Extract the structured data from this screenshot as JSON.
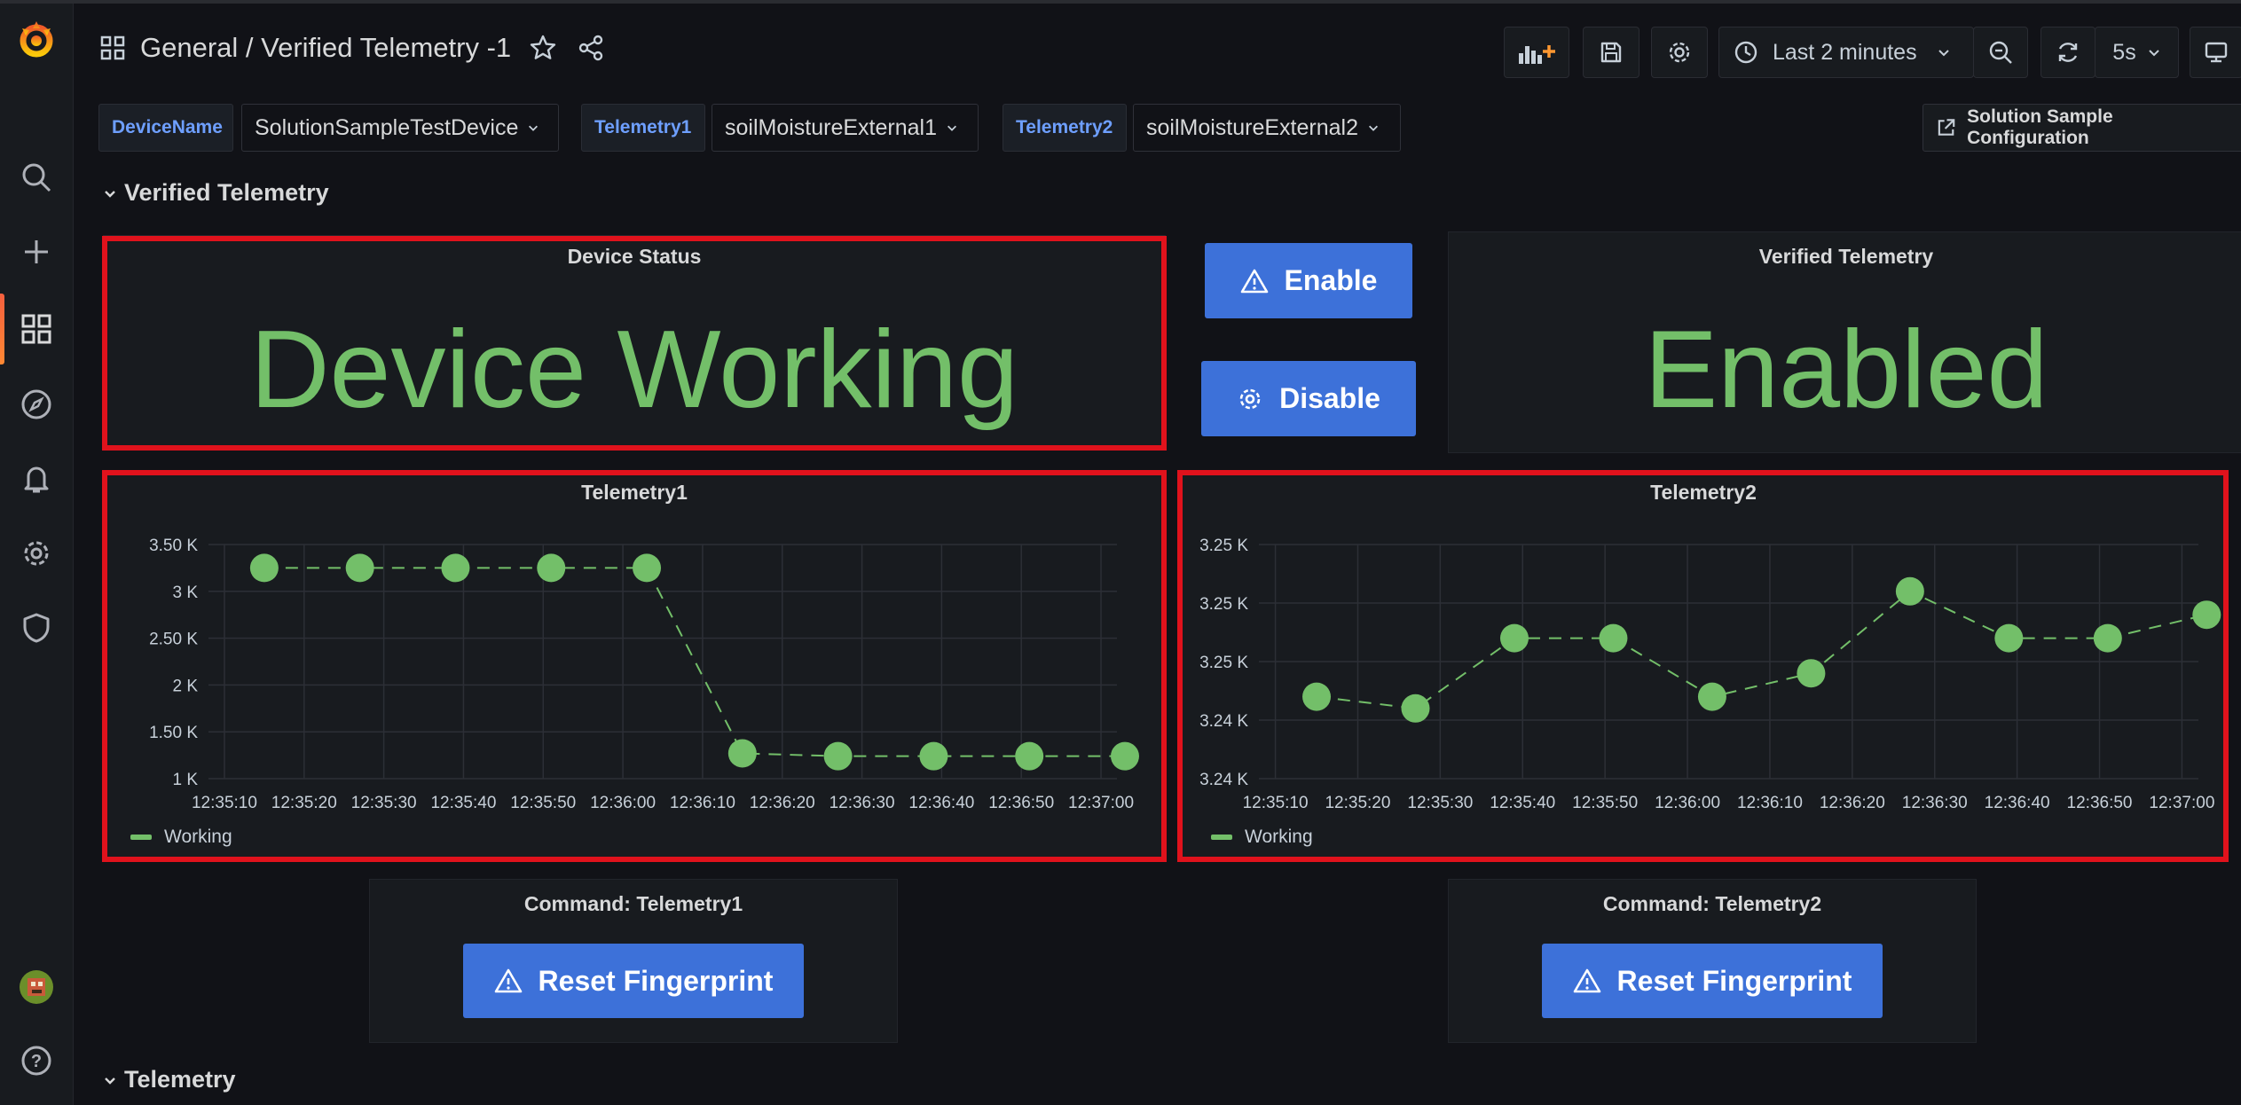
{
  "breadcrumb": {
    "folder": "General",
    "separator": " / ",
    "dashboard": "Verified Telemetry -1"
  },
  "toolbar": {
    "time_range": "Last 2 minutes",
    "refresh_interval": "5s"
  },
  "variables": [
    {
      "label": "DeviceName",
      "value": "SolutionSampleTestDevice"
    },
    {
      "label": "Telemetry1",
      "value": "soilMoistureExternal1"
    },
    {
      "label": "Telemetry2",
      "value": "soilMoistureExternal2"
    }
  ],
  "link": {
    "label": "Solution Sample Configuration"
  },
  "rows": {
    "verified": "Verified Telemetry",
    "telemetry": "Telemetry"
  },
  "panels": {
    "device_status": {
      "title": "Device Status",
      "value": "Device Working"
    },
    "enable_button": "Enable",
    "disable_button": "Disable",
    "verified_telemetry": {
      "title": "Verified Telemetry",
      "value": "Enabled"
    },
    "command1": {
      "title": "Command: Telemetry1",
      "button": "Reset Fingerprint"
    },
    "command2": {
      "title": "Command: Telemetry2",
      "button": "Reset Fingerprint"
    }
  },
  "colors": {
    "accent_green": "#73bf69",
    "button_blue": "#3d71d9",
    "highlight_red": "#e0121c",
    "background": "#111217"
  },
  "chart_data": [
    {
      "type": "line",
      "title": "Telemetry1",
      "x": [
        "12:35:10",
        "12:35:20",
        "12:35:30",
        "12:35:40",
        "12:35:50",
        "12:36:00",
        "12:36:10",
        "12:36:20",
        "12:36:30",
        "12:36:40",
        "12:36:50",
        "12:37:00"
      ],
      "y_ticks": [
        "3.50 K",
        "3 K",
        "2.50 K",
        "2 K",
        "1.50 K",
        "1 K"
      ],
      "ylim": [
        1000,
        3500
      ],
      "series": [
        {
          "name": "Working",
          "points": [
            [
              "12:35:15",
              3250
            ],
            [
              "12:35:27",
              3250
            ],
            [
              "12:35:39",
              3250
            ],
            [
              "12:35:51",
              3250
            ],
            [
              "12:36:03",
              3250
            ],
            [
              "12:36:15",
              1270
            ],
            [
              "12:36:27",
              1240
            ],
            [
              "12:36:39",
              1240
            ],
            [
              "12:36:51",
              1240
            ],
            [
              "12:37:03",
              1240
            ]
          ]
        }
      ],
      "legend": "bottom-left",
      "grid": true
    },
    {
      "type": "line",
      "title": "Telemetry2",
      "x": [
        "12:35:10",
        "12:35:20",
        "12:35:30",
        "12:35:40",
        "12:35:50",
        "12:36:00",
        "12:36:10",
        "12:36:20",
        "12:36:30",
        "12:36:40",
        "12:36:50",
        "12:37:00"
      ],
      "y_ticks": [
        "3.25 K",
        "3.25 K",
        "3.25 K",
        "3.24 K",
        "3.24 K"
      ],
      "ylim": [
        3238,
        3258
      ],
      "series": [
        {
          "name": "Working",
          "points": [
            [
              "12:35:15",
              3245
            ],
            [
              "12:35:27",
              3244
            ],
            [
              "12:35:39",
              3250
            ],
            [
              "12:35:51",
              3250
            ],
            [
              "12:36:03",
              3245
            ],
            [
              "12:36:15",
              3247
            ],
            [
              "12:36:27",
              3254
            ],
            [
              "12:36:39",
              3250
            ],
            [
              "12:36:51",
              3250
            ],
            [
              "12:37:03",
              3252
            ]
          ]
        }
      ],
      "legend": "bottom-left",
      "grid": true
    }
  ]
}
